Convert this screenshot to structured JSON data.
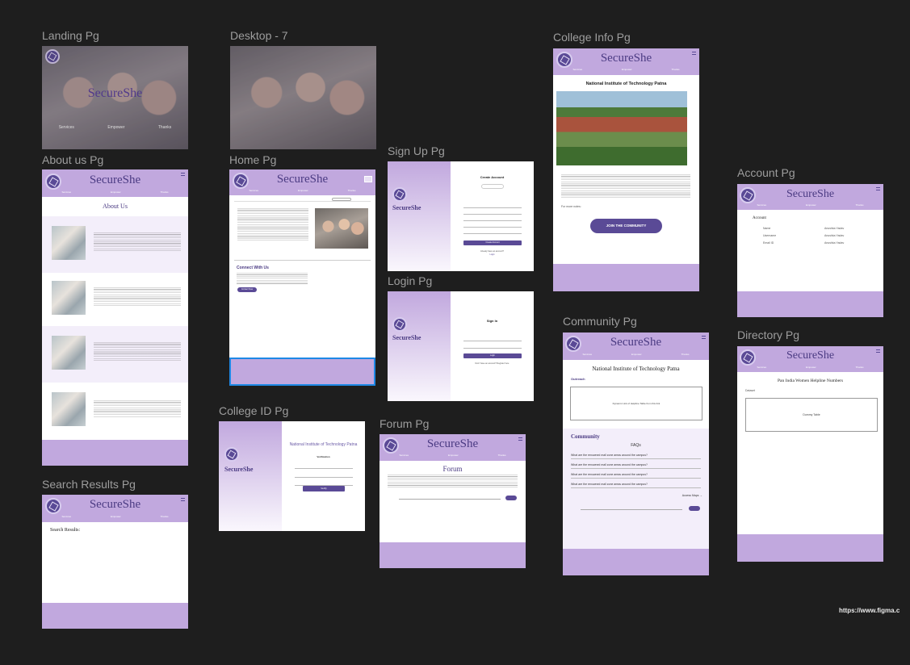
{
  "brand": "SecureShe",
  "colors": {
    "canvas": "#1e1e1e",
    "header": "#c1a8de",
    "accent": "#5a4a96",
    "brand_text": "#4b3b83",
    "selection": "#1e88e5"
  },
  "frames": {
    "landing": {
      "label": "Landing Pg",
      "nav": [
        "Services",
        "Empower",
        "Thanks"
      ]
    },
    "desktop7": {
      "label": "Desktop - 7"
    },
    "about": {
      "label": "About us Pg",
      "nav": [
        "Services",
        "Empower",
        "Thanks"
      ],
      "title": "About Us"
    },
    "search": {
      "label": "Search Results Pg",
      "nav": [
        "Services",
        "Empower",
        "Thanks"
      ],
      "heading": "Search Results:"
    },
    "home": {
      "label": "Home Pg",
      "nav": [
        "Services",
        "Empower",
        "Thanks"
      ],
      "connect_heading": "Connect With Us",
      "connect_button": "Contact Now"
    },
    "collegeid": {
      "label": "College ID Pg",
      "college": "National Institute of Technology Patna",
      "verification": "Verification",
      "button": "Verify"
    },
    "signup": {
      "label": "Sign Up Pg",
      "title": "Create Account",
      "button": "Create Account",
      "footer": "Already have an account?",
      "login": "Login"
    },
    "login": {
      "label": "Login Pg",
      "title": "Sign In",
      "button": "Login",
      "footer": "Don't have an account? Register here"
    },
    "forum": {
      "label": "Forum Pg",
      "nav": [
        "Services",
        "Empower",
        "Thanks"
      ],
      "title": "Forum"
    },
    "collegeinfo": {
      "label": "College Info Pg",
      "nav": [
        "Services",
        "Empower",
        "Thanks"
      ],
      "college": "National Institute of Technology Patna",
      "more": "For more notes:",
      "button": "JOIN THE COMMUNITY"
    },
    "community": {
      "label": "Community Pg",
      "nav": [
        "Services",
        "Empower",
        "Thanks"
      ],
      "college": "National Institute of Technology Patna",
      "outreach": "Outreach",
      "outreach_box": "Dynamic Link of Helpline Table from this link",
      "community": "Community",
      "faqs": "FAQs",
      "questions": [
        "What are the renowned mall zone areas around the campus?",
        "What are the renowned mall zone areas around the campus?",
        "What are the renowned mall zone areas around the campus?",
        "What are the renowned mall zone areas around the campus?"
      ],
      "access_maps": "Access Maps →"
    },
    "account": {
      "label": "Account Pg",
      "nav": [
        "Services",
        "Empower",
        "Thanks"
      ],
      "heading": "Account",
      "rows": [
        {
          "k": "Name",
          "v": "Anushka Yadav"
        },
        {
          "k": "Username",
          "v": "Anushka Yadav"
        },
        {
          "k": "Email ID",
          "v": "Anushka Yadav"
        }
      ]
    },
    "directory": {
      "label": "Directory Pg",
      "nav": [
        "Services",
        "Empower",
        "Thanks"
      ],
      "heading": "Pan India Women Helpline Numbers",
      "sub": "Dataset",
      "table": "Dummy Table"
    }
  },
  "url_snippet": "https://www.figma.c"
}
